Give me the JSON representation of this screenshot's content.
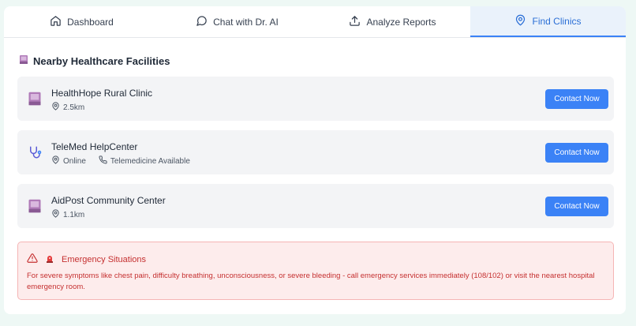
{
  "tabs": [
    {
      "label": "Dashboard",
      "icon": "home-icon"
    },
    {
      "label": "Chat with Dr. AI",
      "icon": "chat-bubble-icon"
    },
    {
      "label": "Analyze Reports",
      "icon": "upload-icon"
    },
    {
      "label": "Find Clinics",
      "icon": "map-pin-icon",
      "active": true
    }
  ],
  "section": {
    "title": "Nearby Healthcare Facilities",
    "icon": "book-icon"
  },
  "clinics": [
    {
      "name": "HealthHope Rural Clinic",
      "icon": "book-icon",
      "distance": "2.5km",
      "button": "Contact Now"
    },
    {
      "name": "TeleMed HelpCenter",
      "icon": "stethoscope-icon",
      "distance": "Online",
      "extra": "Telemedicine Available",
      "button": "Contact Now"
    },
    {
      "name": "AidPost Community Center",
      "icon": "book-icon",
      "distance": "1.1km",
      "button": "Contact Now"
    }
  ],
  "emergency": {
    "title": "Emergency Situations",
    "text": "For severe symptoms like chest pain, difficulty breathing, unconsciousness, or severe bleeding - call emergency services immediately (108/102) or visit the nearest hospital emergency room.",
    "icon": "warning-triangle-icon",
    "siren_icon": "siren-icon"
  },
  "colors": {
    "accent": "#3b82f6",
    "active_tab_bg": "#eaf2fb",
    "danger": "#c53030",
    "danger_bg": "#fdecec",
    "page_bg": "#eef8f5"
  }
}
